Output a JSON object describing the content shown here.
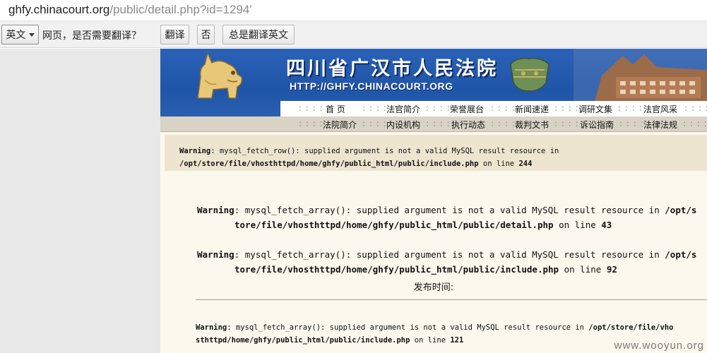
{
  "address_bar": {
    "url_host": "ghfy.chinacourt.org",
    "url_path": "/public/detail.php?id=1294'"
  },
  "translate_bar": {
    "language_label": "英文",
    "question": "网页，是否需要翻译？",
    "translate_button": "翻译",
    "no_button": "否",
    "always_button": "总是翻译英文"
  },
  "site": {
    "title": "四川省广汉市人民法院",
    "url_text": "HTTP://GHFY.CHINACOURT.ORG",
    "nav_row1": [
      "首  页",
      "法官简介",
      "荣誉展台",
      "新闻速递",
      "调研文集",
      "法官风采"
    ],
    "nav_row2": [
      "法院简介",
      "内设机构",
      "执行动态",
      "裁判文书",
      "诉讼指南",
      "法律法规"
    ],
    "separator": ": : : :"
  },
  "warnings": {
    "w1": {
      "label": "Warning",
      "msg": ": mysql_fetch_row(): supplied argument is not a valid MySQL result resource in",
      "path": "/opt/store/file/vhosthttpd/home/ghfy/public_html/public/include.php",
      "on_line": " on line ",
      "line": "244"
    },
    "w2": {
      "label": "Warning",
      "msg": ": mysql_fetch_array(): supplied argument is not a valid MySQL result resource in ",
      "path_a": "/opt/s",
      "path_b": "tore/file/vhosthttpd/home/ghfy/public_html/public/detail.php",
      "on_line": " on line ",
      "line": "43"
    },
    "w3": {
      "label": "Warning",
      "msg": ": mysql_fetch_array(): supplied argument is not a valid MySQL result resource in ",
      "path_a": "/opt/s",
      "path_b": "tore/file/vhosthttpd/home/ghfy/public_html/public/include.php",
      "on_line": " on line ",
      "line": "92"
    },
    "w4": {
      "label": "Warning",
      "msg": ": mysql_fetch_array(): supplied argument is not a valid MySQL result resource in ",
      "path_a": "/opt/store/file/vho",
      "path_b": "sthttpd/home/ghfy/public_html/public/include.php",
      "on_line": " on line ",
      "line": "121"
    }
  },
  "publish_time_label": "发布时间:",
  "watermark": "www.wooyun.org",
  "colors": {
    "banner_blue": "#1f55a8",
    "page_cream": "#fcf8ed",
    "warning_band": "#ede5cf",
    "nav_tan": "#d8d3c4"
  }
}
